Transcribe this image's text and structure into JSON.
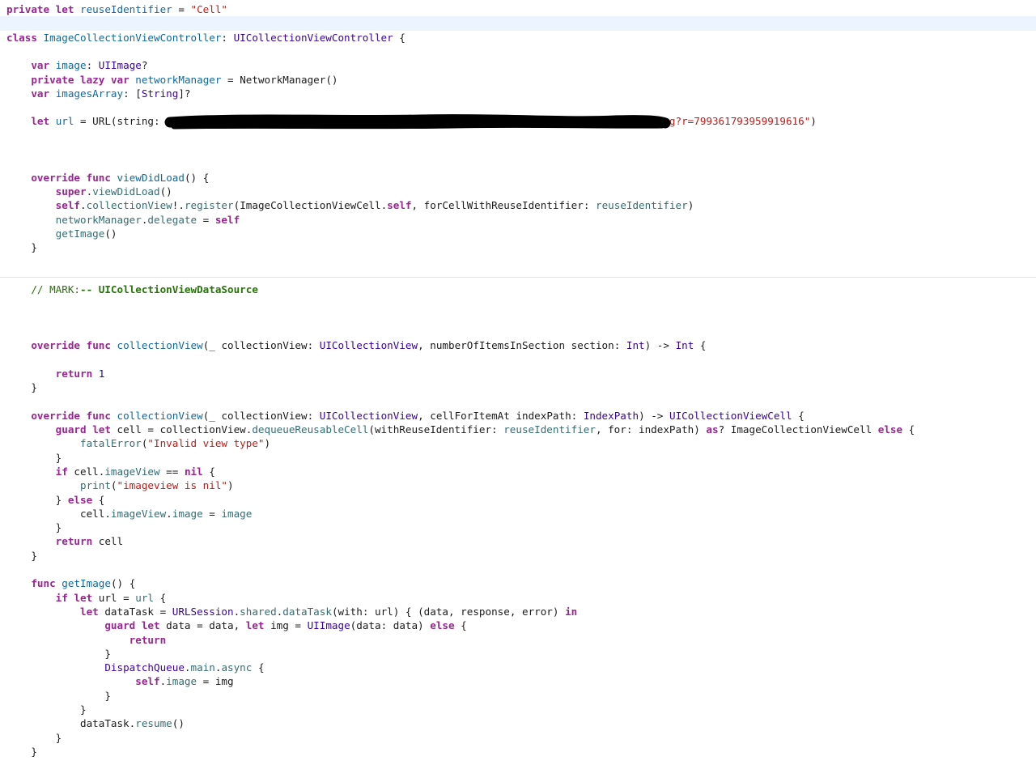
{
  "editor": {
    "colors": {
      "keyword": "#9b2393",
      "string": "#c41a16",
      "type": "#3900a0",
      "property": "#326d74",
      "number": "#1c00cf",
      "comment": "#267507",
      "identifier": "#0f68a0",
      "plain": "#1b1b1b",
      "current_line": "#ecf5ff",
      "redaction": "#000000"
    },
    "lines": [
      [
        [
          "kw",
          "private"
        ],
        [
          "p",
          " "
        ],
        [
          "kw",
          "let"
        ],
        [
          "p",
          " "
        ],
        [
          "id",
          "reuseIdentifier"
        ],
        [
          "p",
          " = "
        ],
        [
          "str",
          "\"Cell\""
        ]
      ],
      [],
      [
        [
          "kw",
          "class"
        ],
        [
          "p",
          " "
        ],
        [
          "id",
          "ImageCollectionViewController"
        ],
        [
          "p",
          ": "
        ],
        [
          "type",
          "UICollectionViewController"
        ],
        [
          "p",
          " {"
        ]
      ],
      [],
      [
        [
          "p",
          "    "
        ],
        [
          "kw",
          "var"
        ],
        [
          "p",
          " "
        ],
        [
          "id",
          "image"
        ],
        [
          "p",
          ": "
        ],
        [
          "type",
          "UIImage"
        ],
        [
          "p",
          "?"
        ]
      ],
      [
        [
          "p",
          "    "
        ],
        [
          "kw",
          "private"
        ],
        [
          "p",
          " "
        ],
        [
          "kw",
          "lazy"
        ],
        [
          "p",
          " "
        ],
        [
          "kw",
          "var"
        ],
        [
          "p",
          " "
        ],
        [
          "id",
          "networkManager"
        ],
        [
          "p",
          " = NetworkManager()"
        ]
      ],
      [
        [
          "p",
          "    "
        ],
        [
          "kw",
          "var"
        ],
        [
          "p",
          " "
        ],
        [
          "id",
          "imagesArray"
        ],
        [
          "p",
          ": ["
        ],
        [
          "type",
          "String"
        ],
        [
          "p",
          "]?"
        ]
      ],
      [],
      [
        [
          "p",
          "    "
        ],
        [
          "kw",
          "let"
        ],
        [
          "p",
          " "
        ],
        [
          "id",
          "url"
        ],
        [
          "p",
          " = URL(string: "
        ],
        [
          "str",
          "\"https://xxxxxxxxxxxxxxxxxxxxxxxxxxxxxxxxxxxxxxxxxxxxxxxxxxxxxxxxxxxxxxxxxxx359.jpg?r=799361793959919616\""
        ],
        [
          "p",
          ")"
        ]
      ],
      [],
      [],
      [],
      [
        [
          "p",
          "    "
        ],
        [
          "kw",
          "override"
        ],
        [
          "p",
          " "
        ],
        [
          "kw",
          "func"
        ],
        [
          "p",
          " "
        ],
        [
          "id",
          "viewDidLoad"
        ],
        [
          "p",
          "() {"
        ]
      ],
      [
        [
          "p",
          "        "
        ],
        [
          "kw",
          "super"
        ],
        [
          "p",
          "."
        ],
        [
          "prop",
          "viewDidLoad"
        ],
        [
          "p",
          "()"
        ]
      ],
      [
        [
          "p",
          "        "
        ],
        [
          "kw",
          "self"
        ],
        [
          "p",
          "."
        ],
        [
          "prop",
          "collectionView"
        ],
        [
          "p",
          "!."
        ],
        [
          "prop",
          "register"
        ],
        [
          "p",
          "(ImageCollectionViewCell."
        ],
        [
          "kw",
          "self"
        ],
        [
          "p",
          ", forCellWithReuseIdentifier: "
        ],
        [
          "prop",
          "reuseIdentifier"
        ],
        [
          "p",
          ")"
        ]
      ],
      [
        [
          "p",
          "        "
        ],
        [
          "prop",
          "networkManager"
        ],
        [
          "p",
          "."
        ],
        [
          "prop",
          "delegate"
        ],
        [
          "p",
          " = "
        ],
        [
          "kw",
          "self"
        ]
      ],
      [
        [
          "p",
          "        "
        ],
        [
          "prop",
          "getImage"
        ],
        [
          "p",
          "()"
        ]
      ],
      [
        [
          "p",
          "    }"
        ]
      ],
      [],
      [],
      [
        [
          "p",
          "    "
        ],
        [
          "cmt",
          "// MARK:"
        ],
        [
          "mark",
          "-- UICollectionViewDataSource"
        ]
      ],
      [],
      [],
      [],
      [
        [
          "p",
          "    "
        ],
        [
          "kw",
          "override"
        ],
        [
          "p",
          " "
        ],
        [
          "kw",
          "func"
        ],
        [
          "p",
          " "
        ],
        [
          "id",
          "collectionView"
        ],
        [
          "p",
          "(_ collectionView: "
        ],
        [
          "type",
          "UICollectionView"
        ],
        [
          "p",
          ", numberOfItemsInSection section: "
        ],
        [
          "type",
          "Int"
        ],
        [
          "p",
          ") -> "
        ],
        [
          "type",
          "Int"
        ],
        [
          "p",
          " {"
        ]
      ],
      [],
      [
        [
          "p",
          "        "
        ],
        [
          "kw",
          "return"
        ],
        [
          "p",
          " "
        ],
        [
          "num",
          "1"
        ]
      ],
      [
        [
          "p",
          "    }"
        ]
      ],
      [],
      [
        [
          "p",
          "    "
        ],
        [
          "kw",
          "override"
        ],
        [
          "p",
          " "
        ],
        [
          "kw",
          "func"
        ],
        [
          "p",
          " "
        ],
        [
          "id",
          "collectionView"
        ],
        [
          "p",
          "(_ collectionView: "
        ],
        [
          "type",
          "UICollectionView"
        ],
        [
          "p",
          ", cellForItemAt indexPath: "
        ],
        [
          "type",
          "IndexPath"
        ],
        [
          "p",
          ") -> "
        ],
        [
          "type",
          "UICollectionViewCell"
        ],
        [
          "p",
          " {"
        ]
      ],
      [
        [
          "p",
          "        "
        ],
        [
          "kw",
          "guard"
        ],
        [
          "p",
          " "
        ],
        [
          "kw",
          "let"
        ],
        [
          "p",
          " cell = collectionView."
        ],
        [
          "prop",
          "dequeueReusableCell"
        ],
        [
          "p",
          "(withReuseIdentifier: "
        ],
        [
          "prop",
          "reuseIdentifier"
        ],
        [
          "p",
          ", for: indexPath) "
        ],
        [
          "kw",
          "as"
        ],
        [
          "p",
          "? ImageCollectionViewCell "
        ],
        [
          "kw",
          "else"
        ],
        [
          "p",
          " {"
        ]
      ],
      [
        [
          "p",
          "            "
        ],
        [
          "prop",
          "fatalError"
        ],
        [
          "p",
          "("
        ],
        [
          "str",
          "\"Invalid view type\""
        ],
        [
          "p",
          ")"
        ]
      ],
      [
        [
          "p",
          "        }"
        ]
      ],
      [
        [
          "p",
          "        "
        ],
        [
          "kw",
          "if"
        ],
        [
          "p",
          " cell."
        ],
        [
          "prop",
          "imageView"
        ],
        [
          "p",
          " == "
        ],
        [
          "kw",
          "nil"
        ],
        [
          "p",
          " {"
        ]
      ],
      [
        [
          "p",
          "            "
        ],
        [
          "prop",
          "print"
        ],
        [
          "p",
          "("
        ],
        [
          "str",
          "\"imageview is nil\""
        ],
        [
          "p",
          ")"
        ]
      ],
      [
        [
          "p",
          "        } "
        ],
        [
          "kw",
          "else"
        ],
        [
          "p",
          " {"
        ]
      ],
      [
        [
          "p",
          "            cell."
        ],
        [
          "prop",
          "imageView"
        ],
        [
          "p",
          "."
        ],
        [
          "prop",
          "image"
        ],
        [
          "p",
          " = "
        ],
        [
          "prop",
          "image"
        ]
      ],
      [
        [
          "p",
          "        }"
        ]
      ],
      [
        [
          "p",
          "        "
        ],
        [
          "kw",
          "return"
        ],
        [
          "p",
          " cell"
        ]
      ],
      [
        [
          "p",
          "    }"
        ]
      ],
      [],
      [
        [
          "p",
          "    "
        ],
        [
          "kw",
          "func"
        ],
        [
          "p",
          " "
        ],
        [
          "id",
          "getImage"
        ],
        [
          "p",
          "() {"
        ]
      ],
      [
        [
          "p",
          "        "
        ],
        [
          "kw",
          "if"
        ],
        [
          "p",
          " "
        ],
        [
          "kw",
          "let"
        ],
        [
          "p",
          " url = "
        ],
        [
          "prop",
          "url"
        ],
        [
          "p",
          " {"
        ]
      ],
      [
        [
          "p",
          "            "
        ],
        [
          "kw",
          "let"
        ],
        [
          "p",
          " dataTask = "
        ],
        [
          "type",
          "URLSession"
        ],
        [
          "p",
          "."
        ],
        [
          "prop",
          "shared"
        ],
        [
          "p",
          "."
        ],
        [
          "prop",
          "dataTask"
        ],
        [
          "p",
          "(with: url) { (data, response, error) "
        ],
        [
          "kw",
          "in"
        ]
      ],
      [
        [
          "p",
          "                "
        ],
        [
          "kw",
          "guard"
        ],
        [
          "p",
          " "
        ],
        [
          "kw",
          "let"
        ],
        [
          "p",
          " data = data, "
        ],
        [
          "kw",
          "let"
        ],
        [
          "p",
          " img = "
        ],
        [
          "type",
          "UIImage"
        ],
        [
          "p",
          "(data: data) "
        ],
        [
          "kw",
          "else"
        ],
        [
          "p",
          " {"
        ]
      ],
      [
        [
          "p",
          "                    "
        ],
        [
          "kw",
          "return"
        ]
      ],
      [
        [
          "p",
          "                }"
        ]
      ],
      [
        [
          "p",
          "                "
        ],
        [
          "type",
          "DispatchQueue"
        ],
        [
          "p",
          "."
        ],
        [
          "prop",
          "main"
        ],
        [
          "p",
          "."
        ],
        [
          "prop",
          "async"
        ],
        [
          "p",
          " {"
        ]
      ],
      [
        [
          "p",
          "                     "
        ],
        [
          "kw",
          "self"
        ],
        [
          "p",
          "."
        ],
        [
          "prop",
          "image"
        ],
        [
          "p",
          " = img"
        ]
      ],
      [
        [
          "p",
          "                }"
        ]
      ],
      [
        [
          "p",
          "            }"
        ]
      ],
      [
        [
          "p",
          "            dataTask."
        ],
        [
          "prop",
          "resume"
        ],
        [
          "p",
          "()"
        ]
      ],
      [
        [
          "p",
          "        }"
        ]
      ],
      [
        [
          "p",
          "    }"
        ]
      ]
    ]
  }
}
